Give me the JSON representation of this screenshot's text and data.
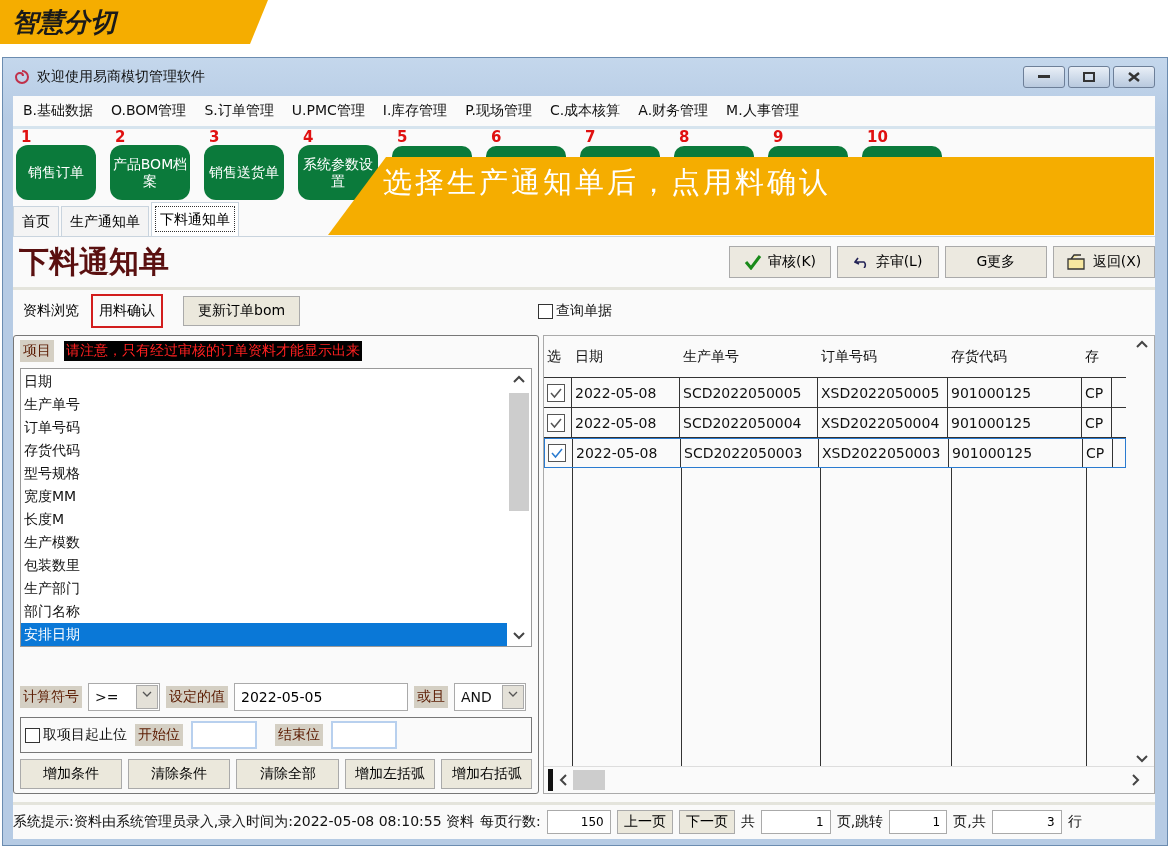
{
  "header": {
    "title": "智慧分切"
  },
  "window": {
    "title": "欢迎使用易商模切管理软件"
  },
  "menu": [
    "B.基础数据",
    "O.BOM管理",
    "S.订单管理",
    "U.PMC管理",
    "I.库存管理",
    "P.现场管理",
    "C.成本核算",
    "A.财务管理",
    "M.人事管理"
  ],
  "toolbar": [
    {
      "number": "1",
      "label": "销售订单"
    },
    {
      "number": "2",
      "label": "产品BOM档案"
    },
    {
      "number": "3",
      "label": "销售送货单"
    },
    {
      "number": "4",
      "label": "系统参数设置"
    },
    {
      "number": "5"
    },
    {
      "number": "6"
    },
    {
      "number": "7"
    },
    {
      "number": "8"
    },
    {
      "number": "9"
    },
    {
      "number": "10"
    }
  ],
  "banner": {
    "text": "选择生产通知单后，点用料确认"
  },
  "tabs": [
    {
      "label": "首页",
      "selected": false
    },
    {
      "label": "生产通知单",
      "selected": false
    },
    {
      "label": "下料通知单",
      "selected": true
    }
  ],
  "form": {
    "title": "下料通知单",
    "buttons": [
      {
        "kind": "approve",
        "label": "审核(K)"
      },
      {
        "kind": "unapprove",
        "label": "弃审(L)"
      },
      {
        "kind": "more",
        "label": "G更多"
      },
      {
        "kind": "back",
        "label": "返回(X)"
      }
    ]
  },
  "subtabs": [
    {
      "label": "资料浏览",
      "selected": false
    },
    {
      "label": "用料确认",
      "selected": true
    }
  ],
  "update_button": "更新订单bom",
  "query_checkbox": {
    "label": "查询单据",
    "checked": false
  },
  "filter": {
    "items_label": "项目",
    "notice": "请注意，只有经过审核的订单资料才能显示出来",
    "items": [
      {
        "label": "日期",
        "selected": false
      },
      {
        "label": "生产单号",
        "selected": false
      },
      {
        "label": "订单号码",
        "selected": false
      },
      {
        "label": "存货代码",
        "selected": false
      },
      {
        "label": "型号规格",
        "selected": false
      },
      {
        "label": "宽度MM",
        "selected": false
      },
      {
        "label": "长度M",
        "selected": false
      },
      {
        "label": "生产模数",
        "selected": false
      },
      {
        "label": "包装数里",
        "selected": false
      },
      {
        "label": "生产部门",
        "selected": false
      },
      {
        "label": "部门名称",
        "selected": false
      },
      {
        "label": "安排日期",
        "selected": true
      }
    ],
    "operator_label": "计算符号",
    "operator": ">=",
    "value_label": "设定的值",
    "value": "2022-05-05",
    "logic_label": "或且",
    "logic": "AND",
    "range_checkbox": {
      "label": "取项目起止位",
      "checked": false
    },
    "start_label": "开始位",
    "end_label": "结束位",
    "buttons": [
      "增加条件",
      "清除条件",
      "清除全部",
      "增加左括弧",
      "增加右括弧"
    ]
  },
  "table": {
    "select_header": "选",
    "columns": [
      "日期",
      "生产单号",
      "订单号码",
      "存货代码",
      "存"
    ],
    "rows": [
      {
        "checked": true,
        "selected": false,
        "cells": [
          "2022-05-08",
          "SCD2022050005",
          "XSD2022050005",
          "901000125",
          "CP"
        ]
      },
      {
        "checked": true,
        "selected": false,
        "cells": [
          "2022-05-08",
          "SCD2022050004",
          "XSD2022050004",
          "901000125",
          "CP"
        ]
      },
      {
        "checked": true,
        "selected": true,
        "cells": [
          "2022-05-08",
          "SCD2022050003",
          "XSD2022050003",
          "901000125",
          "CP"
        ]
      }
    ]
  },
  "status_bar": {
    "message": "系统提示:资料由系统管理员录入,录入时间为:2022-05-08 08:10:55 资料",
    "page_size_label": "每页行数:",
    "page_size": "150",
    "prev": "上一页",
    "next": "下一页",
    "total_label": "共",
    "total_pages": "1",
    "jump_label": "页,跳转",
    "jump_page": "1",
    "rows_label": "页,共",
    "total_rows": "3",
    "rows_unit": "行"
  }
}
